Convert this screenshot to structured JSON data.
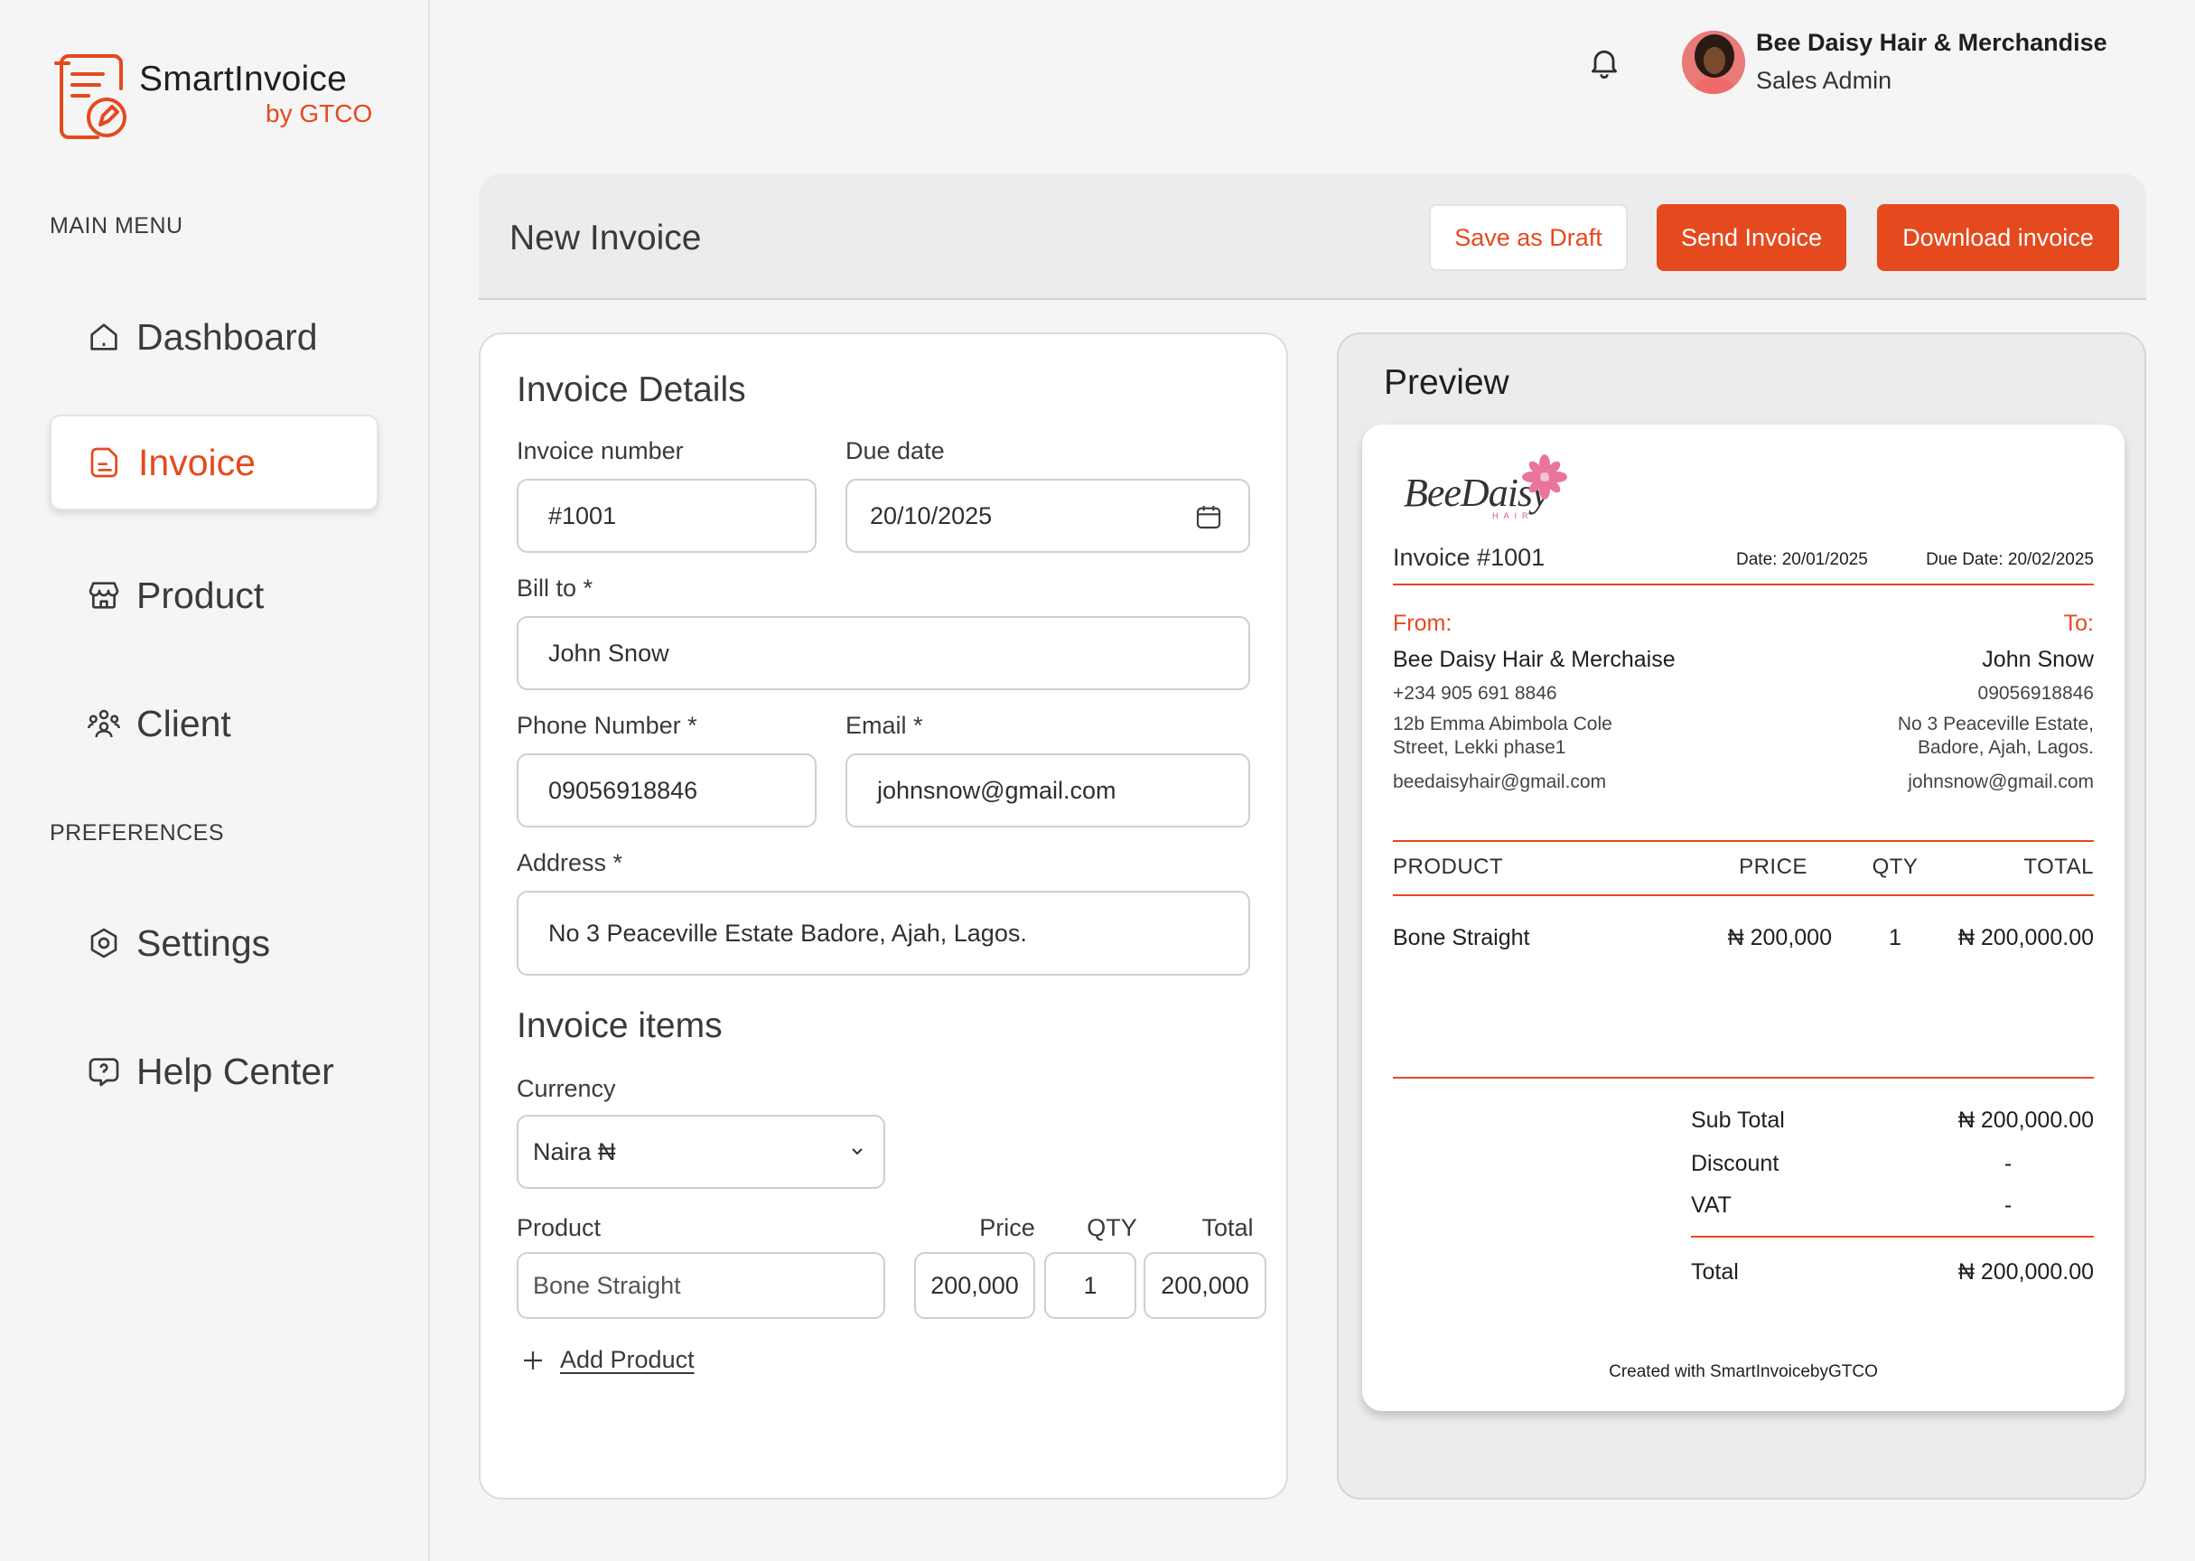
{
  "brand": {
    "name": "SmartInvoice",
    "sub": "by GTCO"
  },
  "sidebar": {
    "main_menu_label": "MAIN MENU",
    "preferences_label": "PREFERENCES",
    "items": [
      {
        "label": "Dashboard",
        "icon": "home-icon"
      },
      {
        "label": "Invoice",
        "icon": "document-icon",
        "active": true
      },
      {
        "label": "Product",
        "icon": "shop-icon"
      },
      {
        "label": "Client",
        "icon": "users-icon"
      },
      {
        "label": "Settings",
        "icon": "gear-icon"
      },
      {
        "label": "Help Center",
        "icon": "help-icon"
      }
    ]
  },
  "header": {
    "user_name": "Bee Daisy Hair & Merchandise",
    "user_role": "Sales Admin"
  },
  "toolbar": {
    "title": "New Invoice",
    "save_draft": "Save as Draft",
    "send": "Send Invoice",
    "download": "Download invoice"
  },
  "form": {
    "title": "Invoice Details",
    "invoice_number_label": "Invoice number",
    "invoice_number": "#1001",
    "due_date_label": "Due date",
    "due_date": "20/10/2025",
    "bill_to_label": "Bill to *",
    "bill_to": "John Snow",
    "phone_label": "Phone Number *",
    "phone": "09056918846",
    "email_label": "Email *",
    "email": "johnsnow@gmail.com",
    "address_label": "Address *",
    "address": "No 3 Peaceville Estate Badore, Ajah, Lagos.",
    "items_title": "Invoice items",
    "currency_label": "Currency",
    "currency": "Naira ₦",
    "product_label": "Product",
    "price_label": "Price",
    "qty_label": "QTY",
    "total_label": "Total",
    "item": {
      "product": "Bone Straight",
      "price": "200,000",
      "qty": "1",
      "total": "200,000"
    },
    "add_product": "Add Product"
  },
  "preview": {
    "title": "Preview",
    "logo": "BeeDaisy",
    "logo_sub": "HAIR",
    "invoice_no": "Invoice #1001",
    "date": "Date: 20/01/2025",
    "due_date": "Due Date: 20/02/2025",
    "from_label": "From:",
    "to_label": "To:",
    "from": {
      "name": "Bee Daisy Hair & Merchaise",
      "phone": "+234 905 691 8846",
      "address1": "12b Emma Abimbola Cole",
      "address2": "Street, Lekki phase1",
      "email": "beedaisyhair@gmail.com"
    },
    "to": {
      "name": "John Snow",
      "phone": "09056918846",
      "address1": "No 3 Peaceville Estate,",
      "address2": "Badore, Ajah, Lagos.",
      "email": "johnsnow@gmail.com"
    },
    "columns": {
      "product": "PRODUCT",
      "price": "PRICE",
      "qty": "QTY",
      "total": "TOTAL"
    },
    "row": {
      "product": "Bone Straight",
      "price": "₦ 200,000",
      "qty": "1",
      "total": "₦ 200,000.00"
    },
    "summary": {
      "subtotal_label": "Sub Total",
      "subtotal": "₦ 200,000.00",
      "discount_label": "Discount",
      "discount": "-",
      "vat_label": "VAT",
      "vat": "-",
      "total_label": "Total",
      "total": "₦ 200,000.00"
    },
    "footer": "Created with SmartInvoicebyGTCO"
  },
  "colors": {
    "accent": "#e44a1e",
    "background": "#f5f5f5"
  }
}
